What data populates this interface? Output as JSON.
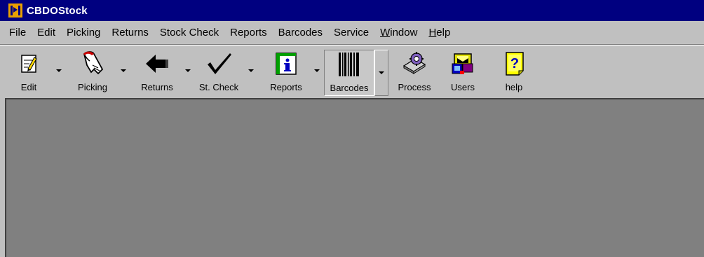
{
  "window": {
    "title": "CBDOStock",
    "icon": "app-icon"
  },
  "menu": [
    {
      "label": "File"
    },
    {
      "label": "Edit"
    },
    {
      "label": "Picking"
    },
    {
      "label": "Returns"
    },
    {
      "label": "Stock Check"
    },
    {
      "label": "Reports"
    },
    {
      "label": "Barcodes"
    },
    {
      "label": "Service"
    },
    {
      "label": "Window",
      "underline": "W"
    },
    {
      "label": "Help",
      "underline": "H"
    }
  ],
  "toolbar": {
    "edit": {
      "label": "Edit",
      "icon": "edit-icon"
    },
    "picking": {
      "label": "Picking",
      "icon": "hand-icon"
    },
    "returns": {
      "label": "Returns",
      "icon": "left-arrow-icon"
    },
    "stcheck": {
      "label": "St. Check",
      "icon": "checkmark-icon"
    },
    "reports": {
      "label": "Reports",
      "icon": "info-book-icon"
    },
    "barcodes": {
      "label": "Barcodes",
      "icon": "barcode-icon",
      "pressed": true
    },
    "process": {
      "label": "Process",
      "icon": "gear-disk-icon"
    },
    "users": {
      "label": "Users",
      "icon": "users-icon"
    },
    "help": {
      "label": "help",
      "icon": "help-icon"
    }
  },
  "colors": {
    "titlebar": "#000080",
    "face": "#c0c0c0",
    "workspace": "#808080"
  }
}
